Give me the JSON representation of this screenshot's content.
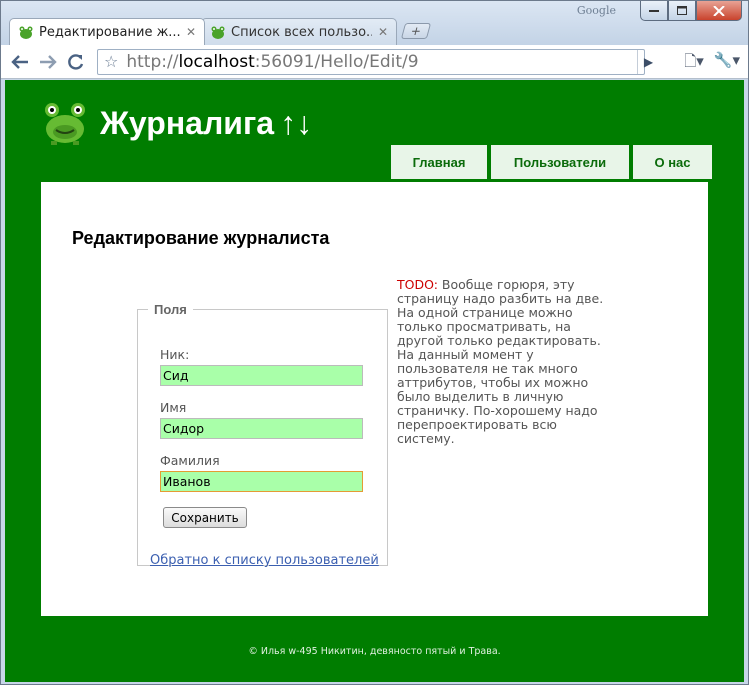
{
  "browser": {
    "brand_label": "Google",
    "tabs": [
      {
        "title": "Редактирование ж...",
        "active": true
      },
      {
        "title": "Список всех пользо...",
        "active": false
      }
    ],
    "url": {
      "scheme": "http://",
      "host": "localhost",
      "rest": ":56091/Hello/Edit/9"
    },
    "icons": {
      "minimize": "minimize-icon",
      "maximize": "maximize-icon",
      "close": "close-icon",
      "back": "back-arrow-icon",
      "forward": "forward-arrow-icon",
      "reload": "reload-icon",
      "bookmark": "star-icon",
      "go": "go-icon",
      "page_menu": "page-icon",
      "tools_menu": "wrench-icon"
    }
  },
  "site": {
    "title": "Журналига",
    "title_arrows": "↑↓",
    "menu": [
      "Главная",
      "Пользователи",
      "О нас"
    ],
    "colors": {
      "background": "#007d00",
      "menu_bg": "#e8f5e8",
      "menu_text": "#0b6b0b"
    }
  },
  "page": {
    "heading": "Редактирование журналиста",
    "form": {
      "legend": "Поля",
      "fields": [
        {
          "label": "Ник:",
          "value": "Сид"
        },
        {
          "label": "Имя",
          "value": "Сидор"
        },
        {
          "label": "Фамилия",
          "value": "Иванов"
        }
      ],
      "save_label": "Сохранить",
      "back_link": "Обратно к списку пользователей",
      "input_color": "#a9ffa9"
    },
    "todo": {
      "tag": "TODO:",
      "text": "Вообще горюря, эту страницу надо разбить на две. На одной странице можно только просматривать, на другой только редактировать. На данный момент у пользователя не так много аттрибутов, чтобы их можно было выделить в личную страничку. По-хорошему надо перепроектировать всю систему."
    }
  },
  "footer": "© Илья w-495 Никитин, девяносто пятый и Трава."
}
